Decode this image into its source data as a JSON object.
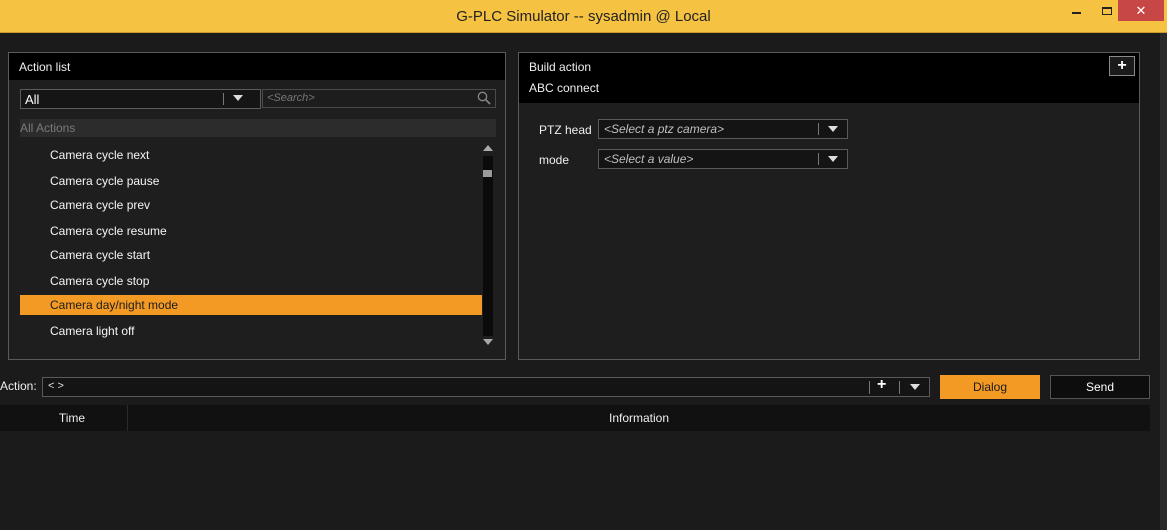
{
  "window": {
    "title": "G-PLC Simulator -- sysadmin @ Local"
  },
  "action_list": {
    "title": "Action list",
    "filter_value": "All",
    "search_placeholder": "<Search>",
    "group_label": "All Actions",
    "items": [
      {
        "label": "Camera cycle next"
      },
      {
        "label": "Camera cycle pause"
      },
      {
        "label": "Camera cycle prev"
      },
      {
        "label": "Camera cycle resume"
      },
      {
        "label": "Camera cycle start"
      },
      {
        "label": "Camera cycle stop"
      },
      {
        "label": "Camera day/night mode"
      },
      {
        "label": "Camera light off"
      }
    ],
    "selected_item": "Camera day/night mode"
  },
  "build_action": {
    "title": "Build action",
    "subtitle": "ABC connect",
    "fields": [
      {
        "label": "PTZ head",
        "placeholder": "<Select a ptz camera>"
      },
      {
        "label": "mode",
        "placeholder": "<Select a value>"
      }
    ]
  },
  "action_bar": {
    "label": "Action:",
    "value": "< >",
    "dialog_label": "Dialog",
    "send_label": "Send"
  },
  "log_table": {
    "columns": [
      "Time",
      "Information"
    ]
  },
  "colors": {
    "accent": "#f39a25",
    "titlebar": "#f5c242",
    "close_button": "#c74646",
    "background": "#1b1b1b"
  }
}
